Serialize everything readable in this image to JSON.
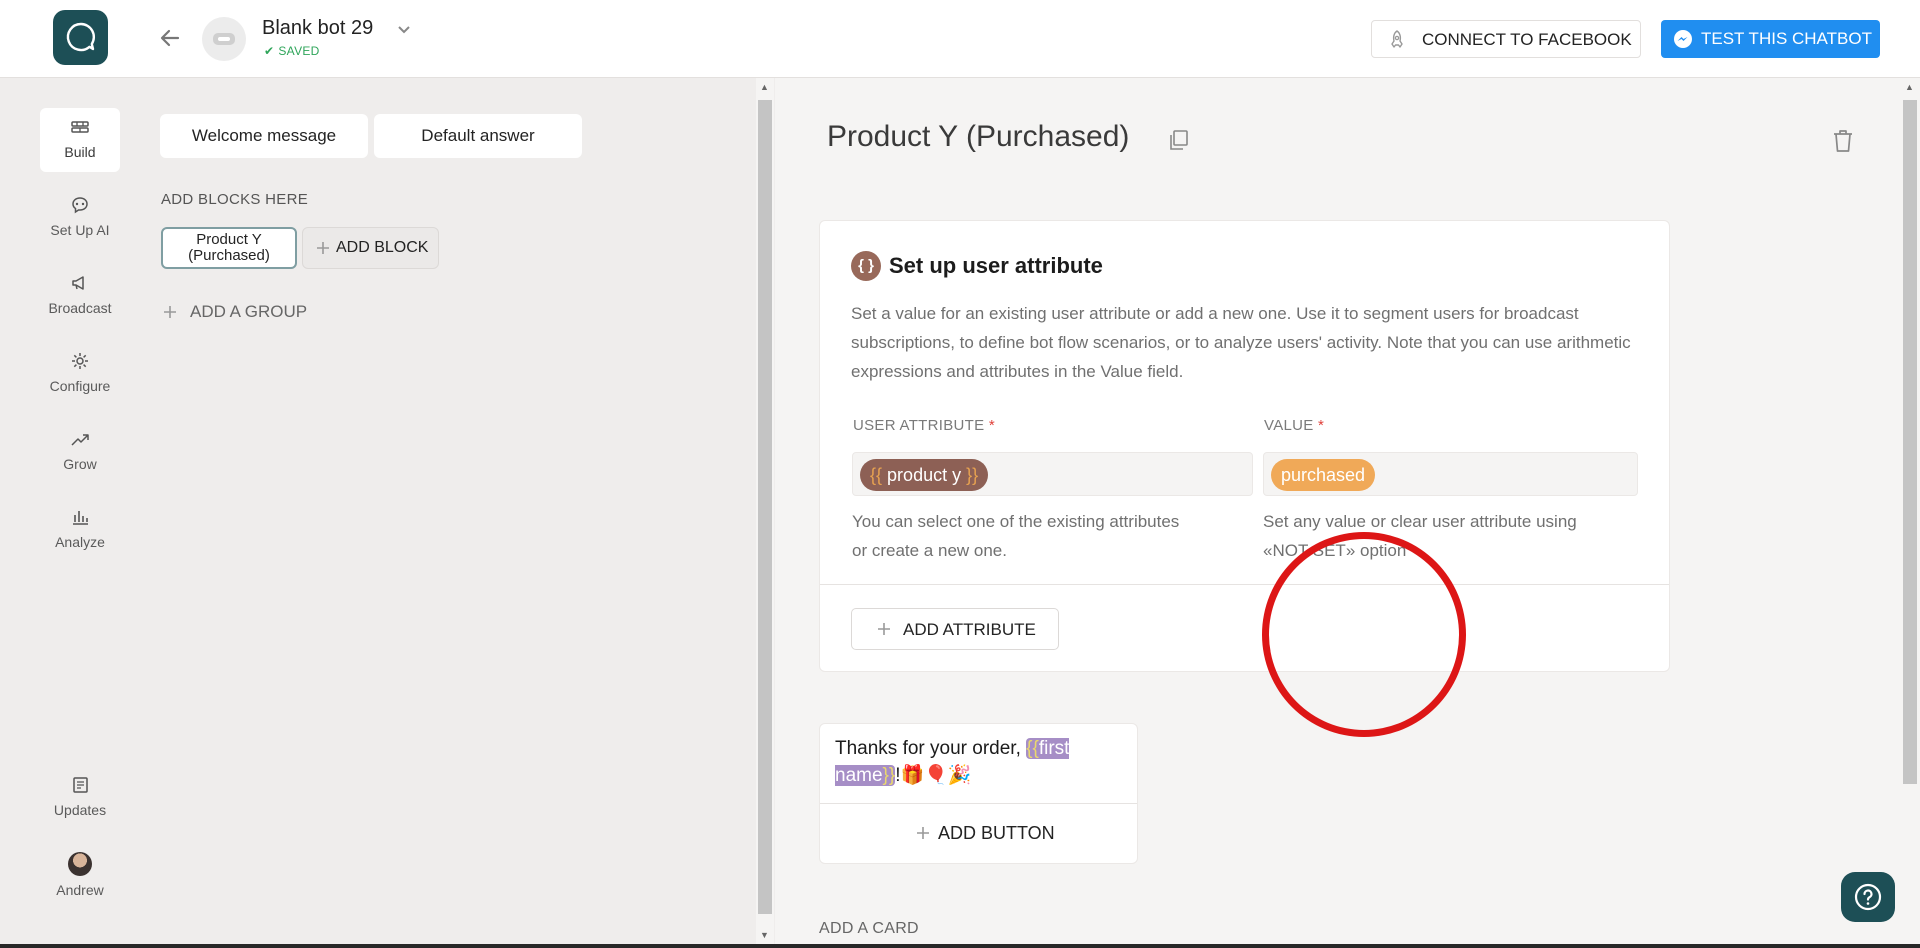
{
  "header": {
    "bot_name": "Blank bot 29",
    "save_status": "SAVED",
    "connect_label": "CONNECT TO FACEBOOK",
    "test_label": "TEST THIS CHATBOT"
  },
  "nav": {
    "items": [
      {
        "label": "Build",
        "icon": "build-icon",
        "active": true
      },
      {
        "label": "Set Up AI",
        "icon": "ai-icon"
      },
      {
        "label": "Broadcast",
        "icon": "megaphone-icon"
      },
      {
        "label": "Configure",
        "icon": "gear-icon"
      },
      {
        "label": "Grow",
        "icon": "growth-icon"
      },
      {
        "label": "Analyze",
        "icon": "bar-chart-icon"
      }
    ],
    "bottom": [
      {
        "label": "Updates",
        "icon": "updates-icon"
      },
      {
        "label": "Andrew",
        "icon": "avatar"
      }
    ]
  },
  "panel": {
    "tabs": [
      "Welcome message",
      "Default answer"
    ],
    "heading": "ADD BLOCKS HERE",
    "block_chip": "Product Y (Purchased)",
    "add_block": "ADD BLOCK",
    "add_group": "ADD A GROUP"
  },
  "editor": {
    "block_title": "Product Y (Purchased)",
    "attr_card": {
      "title": "Set up user attribute",
      "description": "Set a value for an existing user attribute or add a new one. Use it to segment users for broadcast subscriptions, to define bot flow scenarios, or to analyze users' activity. Note that you can use arithmetic expressions and attributes in the Value field.",
      "user_attr_label": "USER ATTRIBUTE",
      "required_mark": "*",
      "value_label": "VALUE",
      "attr_brace_open": "{{",
      "attr_name": "product y",
      "attr_brace_close": "}}",
      "value": "purchased",
      "user_attr_hint_1": "You can select one of the existing attributes",
      "user_attr_hint_2": "or create a new one.",
      "value_hint_1": "Set any value or clear user attribute using",
      "value_hint_2": "«NOT SET» option",
      "add_attribute": "ADD ATTRIBUTE"
    },
    "text_card": {
      "text_before": "Thanks for your order, ",
      "var_open": "{{",
      "var_name_1": "first",
      "var_name_2": "name",
      "var_close": "}}",
      "text_after": "!",
      "emojis": "🎁🎈🎉",
      "add_button": "ADD BUTTON"
    },
    "add_card": "ADD A CARD"
  },
  "colors": {
    "brand": "#1d4f56",
    "primary": "#208ef0",
    "attr_tag": "#8d6055",
    "value_tag": "#f0a958",
    "var_chip": "#a68ec6",
    "highlight_ring": "#dd1616",
    "saved": "#2fa55a"
  }
}
